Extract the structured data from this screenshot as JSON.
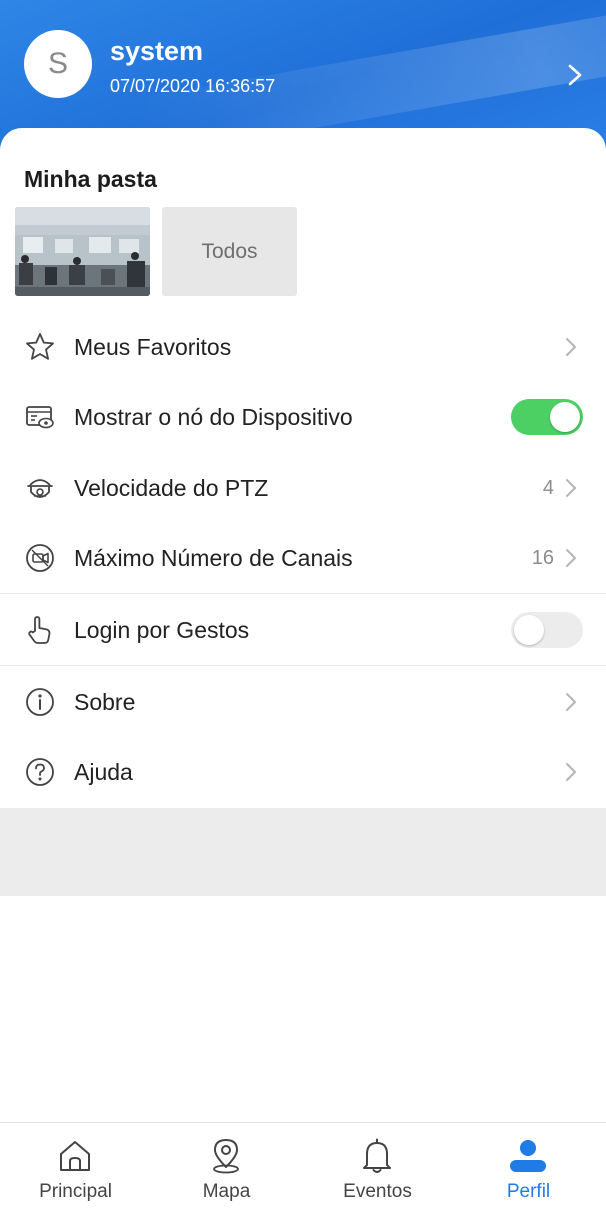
{
  "profile": {
    "avatar_letter": "S",
    "name": "system",
    "datetime": "07/07/2020 16:36:57"
  },
  "folder": {
    "title": "Minha pasta",
    "all_label": "Todos"
  },
  "settings": [
    {
      "label": "Meus Favoritos",
      "icon": "star-icon",
      "value": "",
      "control": "chevron"
    },
    {
      "label": "Mostrar o nó do Dispositivo",
      "icon": "device-node-icon",
      "value": "",
      "control": "toggle",
      "toggle_on": true
    },
    {
      "label": "Velocidade do PTZ",
      "icon": "ptz-camera-icon",
      "value": "4",
      "control": "chevron"
    },
    {
      "label": "Máximo Número de Canais",
      "icon": "channel-camera-icon",
      "value": "16",
      "control": "chevron"
    },
    {
      "label": "Login por Gestos",
      "icon": "gesture-hand-icon",
      "value": "",
      "control": "toggle",
      "toggle_on": false
    },
    {
      "label": "Sobre",
      "icon": "info-icon",
      "value": "",
      "control": "chevron"
    },
    {
      "label": "Ajuda",
      "icon": "help-icon",
      "value": "",
      "control": "chevron"
    }
  ],
  "tabs": [
    {
      "label": "Principal",
      "icon": "home-icon",
      "active": false
    },
    {
      "label": "Mapa",
      "icon": "map-pin-icon",
      "active": false
    },
    {
      "label": "Eventos",
      "icon": "bell-icon",
      "active": false
    },
    {
      "label": "Perfil",
      "icon": "person-icon",
      "active": true
    }
  ],
  "colors": {
    "header_blue": "#2a7ee4",
    "accent_blue": "#1f7be6",
    "toggle_on_green": "#4cd064",
    "toggle_off_gray": "#ececec"
  }
}
